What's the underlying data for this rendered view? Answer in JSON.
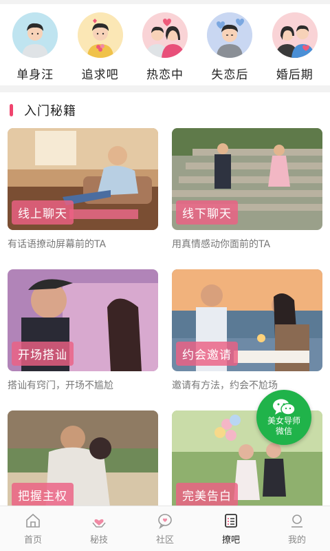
{
  "stages": [
    {
      "label": "单身汪",
      "icon": "single-man-avatar-icon"
    },
    {
      "label": "追求吧",
      "icon": "pursuing-avatar-icon"
    },
    {
      "label": "热恋中",
      "icon": "in-love-couple-icon"
    },
    {
      "label": "失恋后",
      "icon": "heartbroken-avatar-icon"
    },
    {
      "label": "婚后期",
      "icon": "married-couple-icon"
    }
  ],
  "section": {
    "title": "入门秘籍"
  },
  "cards": [
    {
      "tag": "线上聊天",
      "desc": "有话语撩动屏幕前的TA"
    },
    {
      "tag": "线下聊天",
      "desc": "用真情感动你面前的TA"
    },
    {
      "tag": "开场搭讪",
      "desc": "搭讪有窍门，开场不尴尬"
    },
    {
      "tag": "约会邀请",
      "desc": "邀请有方法，约会不尬场"
    },
    {
      "tag": "把握主权",
      "desc": ""
    },
    {
      "tag": "完美告白",
      "desc": ""
    }
  ],
  "float_button": {
    "line1": "美女导师",
    "line2": "微信",
    "icon": "wechat-icon"
  },
  "nav": [
    {
      "label": "首页",
      "icon": "home-icon",
      "active": false
    },
    {
      "label": "秘技",
      "icon": "heart-hands-icon",
      "active": false
    },
    {
      "label": "社区",
      "icon": "chat-heart-icon",
      "active": false
    },
    {
      "label": "撩吧",
      "icon": "list-icon",
      "active": true
    },
    {
      "label": "我的",
      "icon": "profile-icon",
      "active": false
    }
  ],
  "colors": {
    "accent": "#f0456e",
    "tag_bg": "#ec6084",
    "wechat": "#20b34a"
  }
}
